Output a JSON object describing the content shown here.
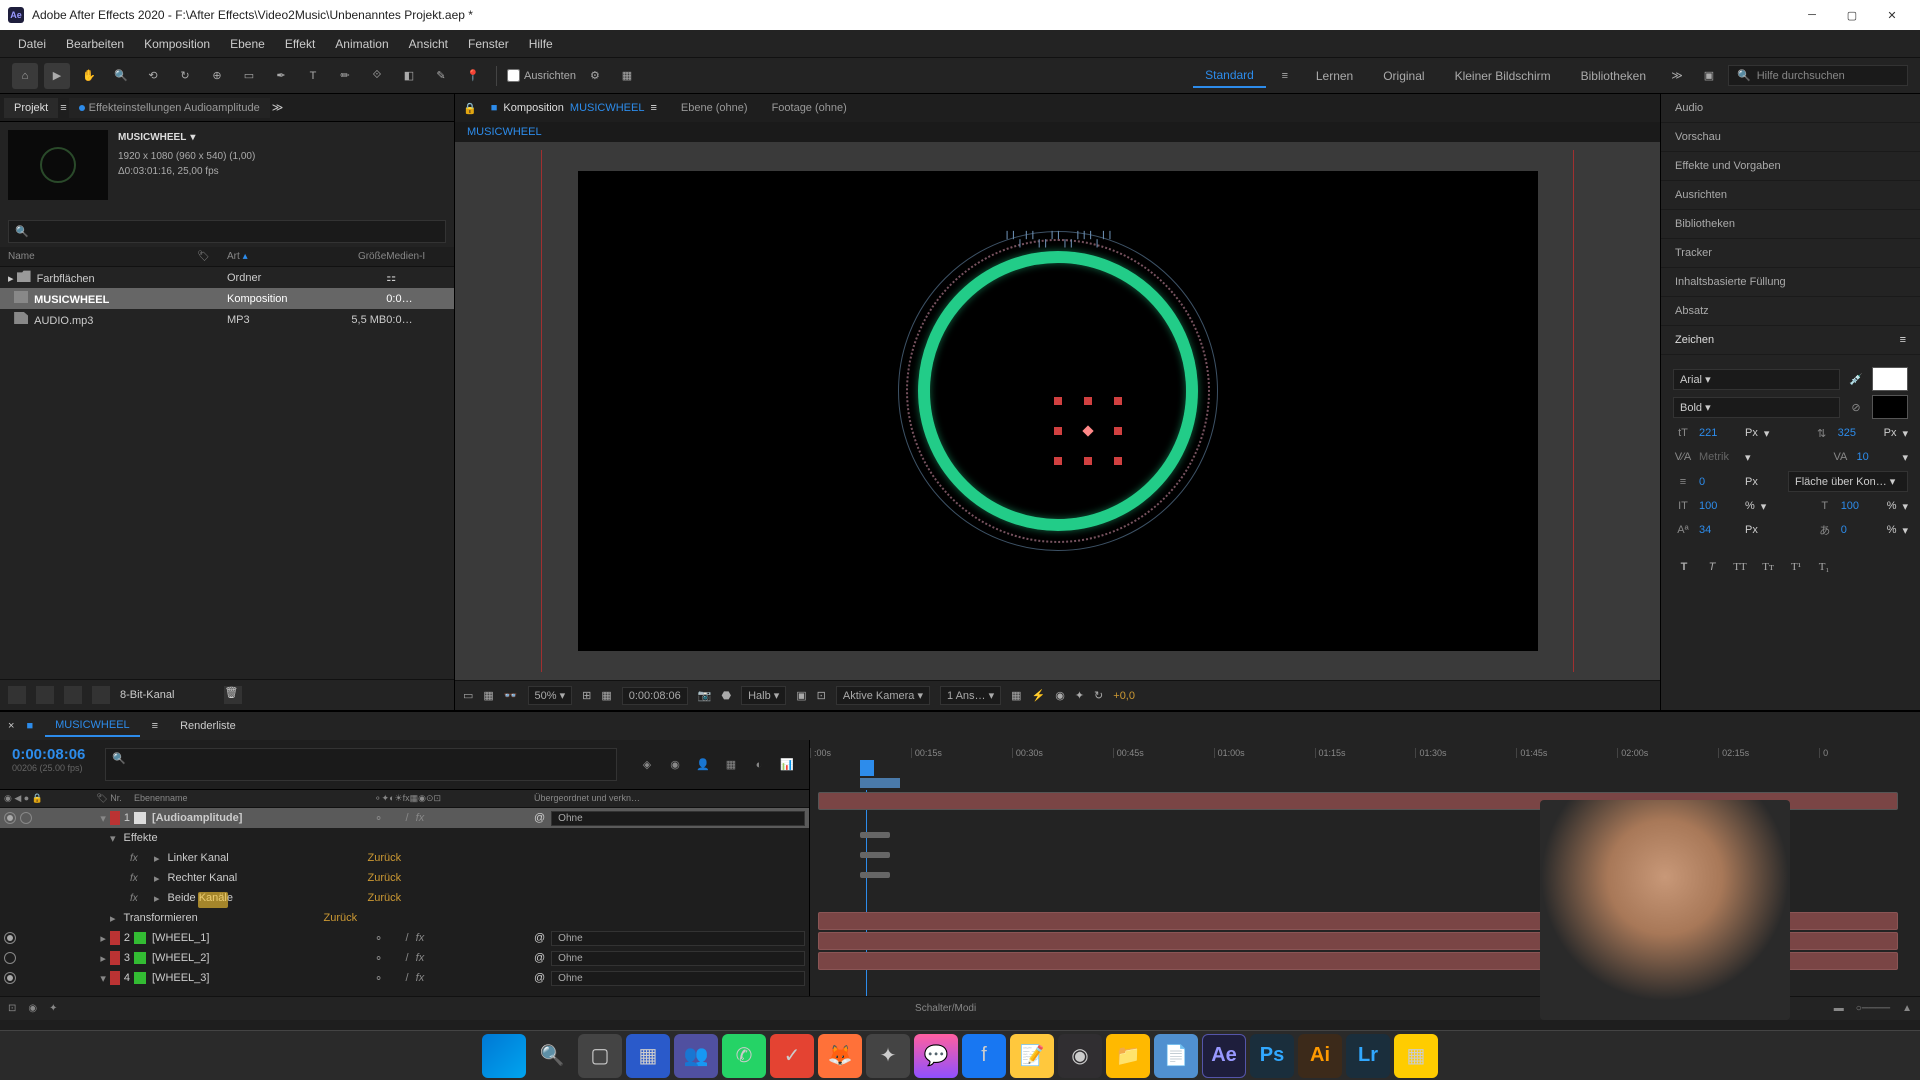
{
  "titlebar": {
    "app_icon": "Ae",
    "title": "Adobe After Effects 2020 - F:\\After Effects\\Video2Music\\Unbenanntes Projekt.aep *"
  },
  "menubar": [
    "Datei",
    "Bearbeiten",
    "Komposition",
    "Ebene",
    "Effekt",
    "Animation",
    "Ansicht",
    "Fenster",
    "Hilfe"
  ],
  "toolbar": {
    "ausrichten": "Ausrichten",
    "workspaces": [
      "Standard",
      "Lernen",
      "Original",
      "Kleiner Bildschirm",
      "Bibliotheken"
    ],
    "active_ws": "Standard",
    "search_placeholder": "Hilfe durchsuchen"
  },
  "left": {
    "tabs": {
      "projekt": "Projekt",
      "effekt": "Effekteinstellungen Audioamplitude"
    },
    "proj_name": "MUSICWHEEL",
    "proj_res": "1920 x 1080 (960 x 540) (1,00)",
    "proj_dur": "Δ0:03:01:16, 25,00 fps",
    "columns": {
      "name": "Name",
      "type": "Art",
      "size": "Größe",
      "media": "Medien-I"
    },
    "items": [
      {
        "name": "Farbflächen",
        "type": "Ordner",
        "size": "",
        "kind": "folder"
      },
      {
        "name": "MUSICWHEEL",
        "type": "Komposition",
        "size": "",
        "media": "0:0…",
        "kind": "comp",
        "selected": true
      },
      {
        "name": "AUDIO.mp3",
        "type": "MP3",
        "size": "5,5 MB",
        "media": "0:0…",
        "kind": "file"
      }
    ],
    "footer_label": "8-Bit-Kanal"
  },
  "viewer": {
    "tabs": {
      "komp_prefix": "Komposition",
      "komp_name": "MUSICWHEEL",
      "ebene": "Ebene (ohne)",
      "footage": "Footage (ohne)"
    },
    "crumb": "MUSICWHEEL",
    "footer": {
      "zoom": "50%",
      "timecode": "0:00:08:06",
      "res": "Halb",
      "camera": "Aktive Kamera",
      "views": "1 Ans…",
      "exposure": "+0,0"
    }
  },
  "right": {
    "panels": [
      "Audio",
      "Vorschau",
      "Effekte und Vorgaben",
      "Ausrichten",
      "Bibliotheken",
      "Tracker",
      "Inhaltsbasierte Füllung",
      "Absatz",
      "Zeichen"
    ],
    "char": {
      "font": "Arial",
      "weight": "Bold",
      "size": "221",
      "size_unit": "Px",
      "leading": "325",
      "leading_unit": "Px",
      "kern": "Metrik",
      "track": "10",
      "stroke": "0",
      "stroke_unit": "Px",
      "stroke_mode": "Fläche über Kon…",
      "vscale": "100",
      "hscale": "100",
      "pct": "%",
      "baseline": "34",
      "baseline_unit": "Px",
      "tsume": "0"
    }
  },
  "timeline": {
    "tabs": {
      "comp": "MUSICWHEEL",
      "render": "Renderliste"
    },
    "timecode": "0:00:08:06",
    "frames": "00206 (25.00 fps)",
    "ruler": [
      ":00s",
      "00:15s",
      "00:30s",
      "00:45s",
      "01:00s",
      "01:15s",
      "01:30s",
      "01:45s",
      "02:00s",
      "02:15s",
      "0"
    ],
    "header": {
      "nr": "Nr.",
      "name": "Ebenenname",
      "parent": "Übergeordnet und verkn…"
    },
    "parent_none": "Ohne",
    "layer1": {
      "num": "1",
      "name": "[Audioamplitude]"
    },
    "effekte": "Effekte",
    "channels": {
      "linker": "Linker Kanal",
      "rechter": "Rechter Kanal",
      "beide": "Beide Kanäle",
      "transform": "Transformieren",
      "reset": "Zurück"
    },
    "wheels": [
      {
        "num": "2",
        "name": "[WHEEL_1]"
      },
      {
        "num": "3",
        "name": "[WHEEL_2]"
      },
      {
        "num": "4",
        "name": "[WHEEL_3]"
      }
    ],
    "footer": "Schalter/Modi"
  },
  "taskbar": {
    "apps": [
      "windows",
      "search",
      "tasks",
      "files",
      "teams",
      "whatsapp",
      "todoist",
      "firefox",
      "app1",
      "messenger",
      "facebook",
      "notes",
      "obs",
      "explorer",
      "editor",
      "ae",
      "ps",
      "ai",
      "lr",
      "app2"
    ]
  }
}
